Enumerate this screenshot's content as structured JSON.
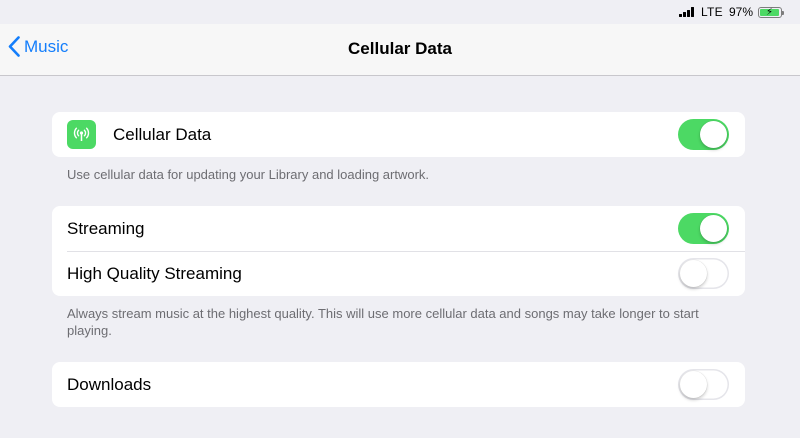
{
  "status_bar": {
    "network": "LTE",
    "battery_percent": "97%",
    "battery_level": 0.97,
    "charging": true
  },
  "nav": {
    "back_label": "Music",
    "title": "Cellular Data"
  },
  "sections": {
    "cellular": {
      "label": "Cellular Data",
      "icon": "antenna-icon",
      "enabled": true,
      "footer": "Use cellular data for updating your Library and loading artwork."
    },
    "streaming": {
      "label": "Streaming",
      "enabled": true
    },
    "high_quality": {
      "label": "High Quality Streaming",
      "enabled": false,
      "footer": "Always stream music at the highest quality. This will use more cellular data and songs may take longer to start playing."
    },
    "downloads": {
      "label": "Downloads",
      "enabled": false
    }
  },
  "colors": {
    "accent": "#147efb",
    "toggle_on": "#4cd964",
    "background": "#efeff4"
  }
}
